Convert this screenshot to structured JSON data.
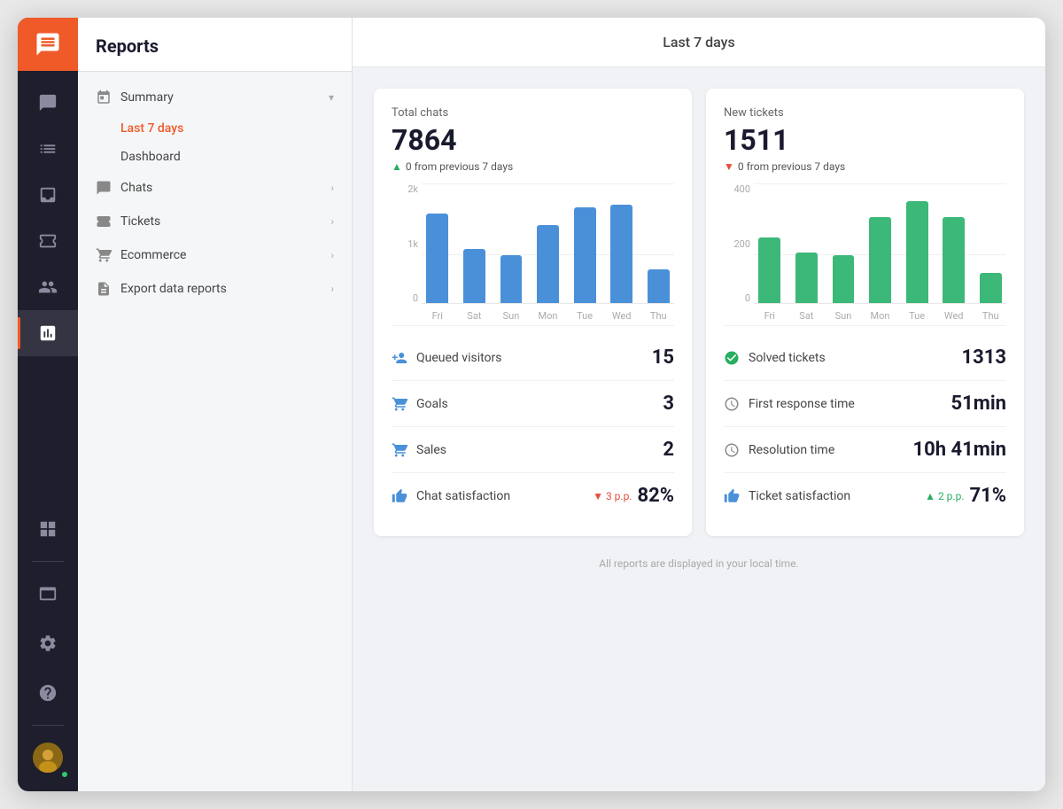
{
  "app": {
    "title": "Reports",
    "period": "Last 7 days"
  },
  "sidebar_icons": {
    "logo_icon": "chat-icon",
    "items": [
      {
        "name": "chat-icon",
        "label": "Chat",
        "active": false
      },
      {
        "name": "list-icon",
        "label": "List",
        "active": false
      },
      {
        "name": "inbox-icon",
        "label": "Inbox",
        "active": false
      },
      {
        "name": "ticket-icon",
        "label": "Tickets",
        "active": false
      },
      {
        "name": "contacts-icon",
        "label": "Contacts",
        "active": false
      },
      {
        "name": "reports-icon",
        "label": "Reports",
        "active": true
      }
    ],
    "bottom_items": [
      {
        "name": "grid-icon",
        "label": "Grid"
      },
      {
        "name": "divider-icon",
        "label": "Divider"
      },
      {
        "name": "browser-icon",
        "label": "Browser"
      },
      {
        "name": "settings-icon",
        "label": "Settings"
      },
      {
        "name": "help-icon",
        "label": "Help"
      }
    ]
  },
  "nav_menu": {
    "items": [
      {
        "label": "Summary",
        "icon": "calendar-icon",
        "has_chevron": true,
        "expanded": true,
        "sub_items": [
          {
            "label": "Last 7 days",
            "active": true
          },
          {
            "label": "Dashboard",
            "active": false
          }
        ]
      },
      {
        "label": "Chats",
        "icon": "chat-bubble-icon",
        "has_chevron": true,
        "expanded": false
      },
      {
        "label": "Tickets",
        "icon": "ticket-nav-icon",
        "has_chevron": true,
        "expanded": false
      },
      {
        "label": "Ecommerce",
        "icon": "cart-icon",
        "has_chevron": true,
        "expanded": false
      },
      {
        "label": "Export data reports",
        "icon": "export-icon",
        "has_chevron": true,
        "expanded": false
      }
    ]
  },
  "total_chats": {
    "title": "Total chats",
    "value": "7864",
    "change_text": "0 from previous 7 days",
    "change_direction": "up",
    "chart": {
      "y_labels": [
        "2k",
        "1k",
        "0"
      ],
      "x_labels": [
        "Fri",
        "Sat",
        "Sun",
        "Mon",
        "Tue",
        "Wed",
        "Thu"
      ],
      "bars": [
        75,
        45,
        40,
        65,
        80,
        82,
        28
      ]
    }
  },
  "new_tickets": {
    "title": "New tickets",
    "value": "1511",
    "change_text": "0 from previous 7 days",
    "change_direction": "down",
    "chart": {
      "y_labels": [
        "400",
        "200",
        "0"
      ],
      "x_labels": [
        "Fri",
        "Sat",
        "Sun",
        "Mon",
        "Tue",
        "Wed",
        "Thu"
      ],
      "bars": [
        55,
        42,
        40,
        72,
        85,
        72,
        25
      ]
    }
  },
  "stats_left": [
    {
      "icon": "queue-icon",
      "label": "Queued visitors",
      "value": "15"
    },
    {
      "icon": "goals-icon",
      "label": "Goals",
      "value": "3"
    },
    {
      "icon": "sales-icon",
      "label": "Sales",
      "value": "2"
    },
    {
      "icon": "thumbs-up-icon",
      "label": "Chat satisfaction",
      "value": "82%",
      "badge": "3 p.p.",
      "badge_direction": "down"
    }
  ],
  "stats_right": [
    {
      "icon": "check-circle-icon",
      "label": "Solved tickets",
      "value": "1313"
    },
    {
      "icon": "clock-icon",
      "label": "First response time",
      "value": "51min"
    },
    {
      "icon": "clock-icon",
      "label": "Resolution time",
      "value": "10h 41min"
    },
    {
      "icon": "thumbs-up-icon",
      "label": "Ticket satisfaction",
      "value": "71%",
      "badge": "2 p.p.",
      "badge_direction": "up"
    }
  ],
  "footer": {
    "note": "All reports are displayed in your local time."
  }
}
